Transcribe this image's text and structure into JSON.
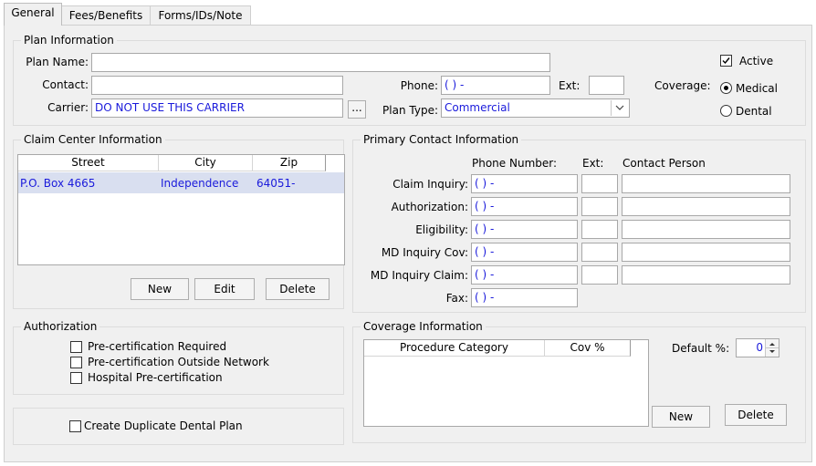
{
  "tabs": [
    "General",
    "Fees/Benefits",
    "Forms/IDs/Note"
  ],
  "plan_info": {
    "legend": "Plan Information",
    "plan_name_label": "Plan Name:",
    "plan_name_value": "",
    "contact_label": "Contact:",
    "contact_value": "",
    "carrier_label": "Carrier:",
    "carrier_value": "DO NOT USE THIS CARRIER",
    "browse_label": "...",
    "phone_label": "Phone:",
    "phone_value": "(   )     -",
    "ext_label": "Ext:",
    "ext_value": "",
    "plan_type_label": "Plan Type:",
    "plan_type_value": "Commercial",
    "active_label": "Active",
    "active_checked": true,
    "coverage_label": "Coverage:",
    "medical_label": "Medical",
    "dental_label": "Dental",
    "coverage_selected": "Medical"
  },
  "claim_center": {
    "legend": "Claim Center Information",
    "columns": [
      "Street",
      "City",
      "Zip"
    ],
    "rows": [
      {
        "street": "P.O. Box 4665",
        "city": "Independence",
        "zip": "64051-"
      }
    ],
    "new_label": "New",
    "edit_label": "Edit",
    "delete_label": "Delete"
  },
  "primary_contact": {
    "legend": "Primary Contact Information",
    "col_phone": "Phone Number:",
    "col_ext": "Ext:",
    "col_person": "Contact Person",
    "rows": [
      {
        "label": "Claim Inquiry:",
        "phone": "(   )     -"
      },
      {
        "label": "Authorization:",
        "phone": "(   )     -"
      },
      {
        "label": "Eligibility:",
        "phone": "(   )     -"
      },
      {
        "label": "MD Inquiry Cov:",
        "phone": "(   )     -"
      },
      {
        "label": "MD Inquiry Claim:",
        "phone": "(   )     -"
      }
    ],
    "fax_label": "Fax:",
    "fax_value": "(   )     -"
  },
  "authorization": {
    "legend": "Authorization",
    "items": [
      "Pre-certification Required",
      "Pre-certification Outside Network",
      "Hospital Pre-certification"
    ]
  },
  "duplicate": {
    "label": "Create Duplicate Dental Plan"
  },
  "coverage_info": {
    "legend": "Coverage Information",
    "columns": [
      "Procedure Category",
      "Cov %"
    ],
    "default_label": "Default %:",
    "default_value": "0",
    "new_label": "New",
    "delete_label": "Delete"
  }
}
